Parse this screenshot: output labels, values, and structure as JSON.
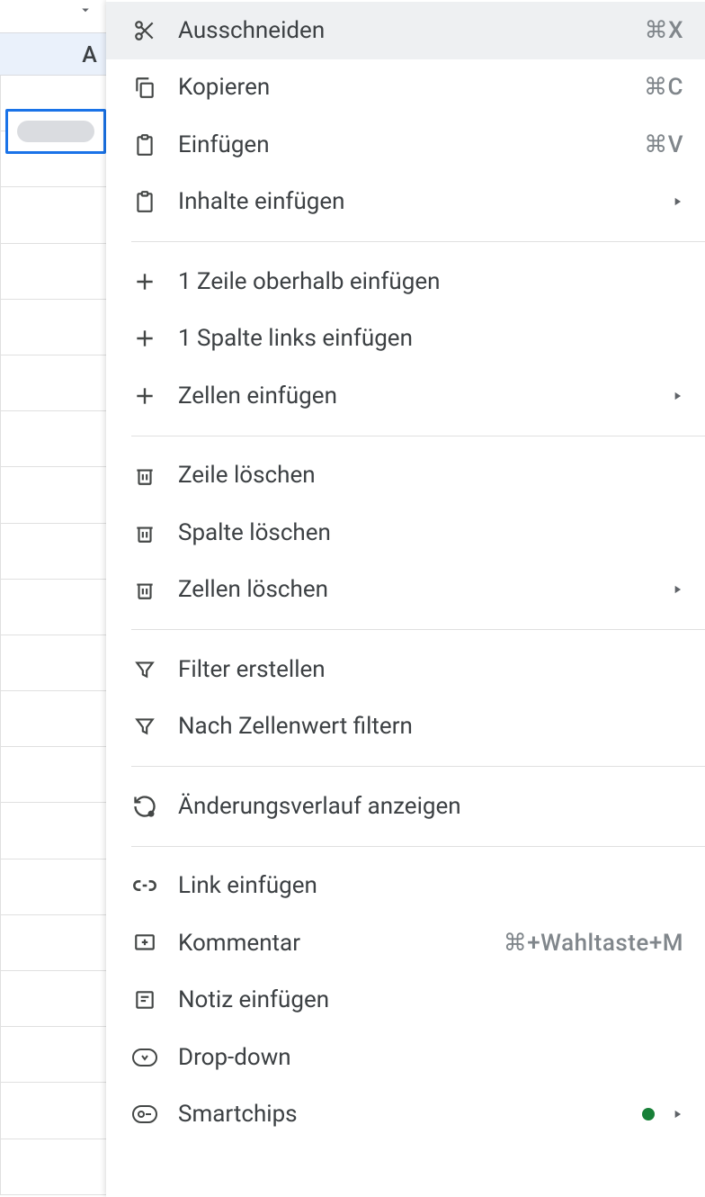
{
  "column_header": "A",
  "menu": {
    "cut": {
      "label": "Ausschneiden",
      "shortcut": "⌘X"
    },
    "copy": {
      "label": "Kopieren",
      "shortcut": "⌘C"
    },
    "paste": {
      "label": "Einfügen",
      "shortcut": "⌘V"
    },
    "paste_special": {
      "label": "Inhalte einfügen"
    },
    "insert_row_above": {
      "label": "1 Zeile oberhalb einfügen"
    },
    "insert_col_left": {
      "label": "1 Spalte links einfügen"
    },
    "insert_cells": {
      "label": "Zellen einfügen"
    },
    "delete_row": {
      "label": "Zeile löschen"
    },
    "delete_col": {
      "label": "Spalte löschen"
    },
    "delete_cells": {
      "label": "Zellen löschen"
    },
    "create_filter": {
      "label": "Filter erstellen"
    },
    "filter_by_value": {
      "label": "Nach Zellenwert filtern"
    },
    "show_edit_history": {
      "label": "Änderungsverlauf anzeigen"
    },
    "insert_link": {
      "label": "Link einfügen"
    },
    "comment": {
      "label": "Kommentar",
      "shortcut": "⌘+Wahltaste+M"
    },
    "insert_note": {
      "label": "Notiz einfügen"
    },
    "dropdown": {
      "label": "Drop-down"
    },
    "smartchips": {
      "label": "Smartchips"
    }
  }
}
